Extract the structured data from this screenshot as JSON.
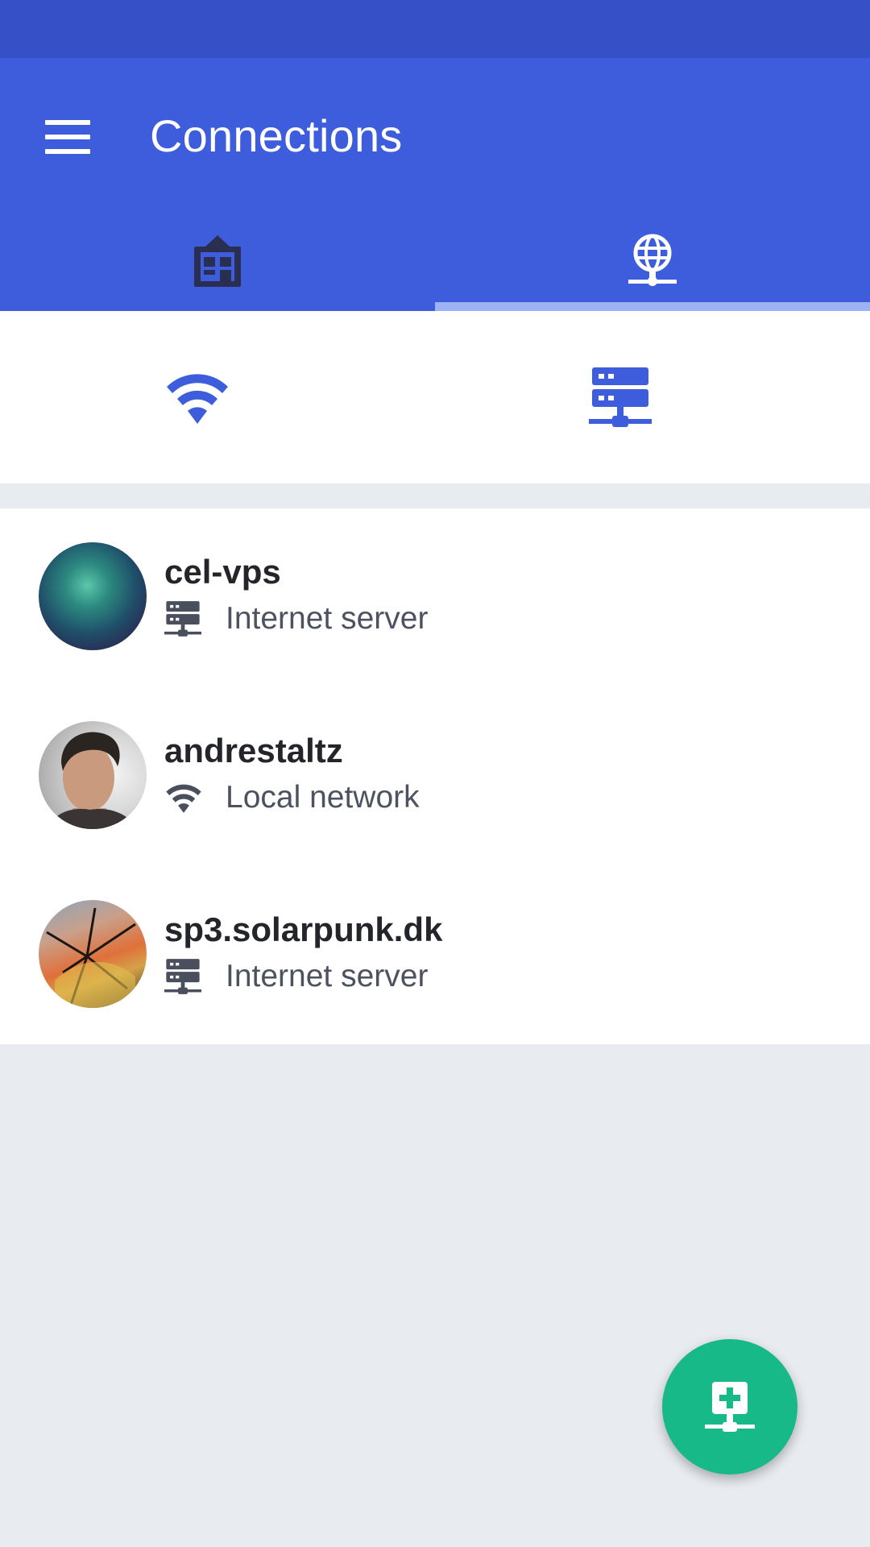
{
  "app_bar": {
    "title": "Connections",
    "menu_icon": "hamburger-menu-icon",
    "tabs": [
      {
        "icon": "building-icon",
        "selected": false
      },
      {
        "icon": "globe-network-icon",
        "selected": true
      }
    ]
  },
  "subtabs": [
    {
      "icon": "wifi-icon"
    },
    {
      "icon": "server-icon"
    }
  ],
  "connections": [
    {
      "name": "cel-vps",
      "type_icon": "server-icon",
      "type": "Internet server"
    },
    {
      "name": "andrestaltz",
      "type_icon": "wifi-icon",
      "type": "Local network"
    },
    {
      "name": "sp3.solarpunk.dk",
      "type_icon": "server-icon",
      "type": "Internet server"
    }
  ],
  "fab": {
    "icon": "add-server-icon"
  },
  "colors": {
    "status_bar": "#3651c8",
    "app_bar": "#3d5ddc",
    "tab_indicator": "#9db1f5",
    "accent_icon": "#3d5ddc",
    "fab": "#16b987",
    "background": "#e8ebef"
  }
}
